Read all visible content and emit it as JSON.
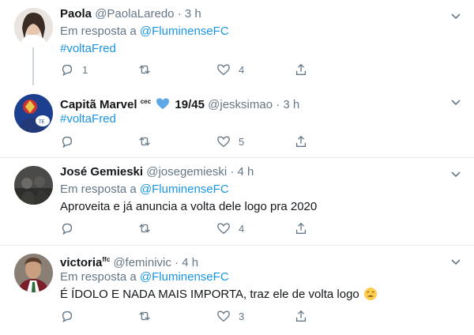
{
  "reply_prefix": "Em resposta a",
  "tweets": [
    {
      "name": "Paola",
      "handle": "@PaolaLaredo",
      "dot": "·",
      "time": "3 h",
      "reply_to": "@FluminenseFC",
      "text": "#voltaFred",
      "replies": "1",
      "retweets": "",
      "likes": "4"
    },
    {
      "name": "Capitã Marvel",
      "name_super": "cec",
      "name_suffix": "19/45",
      "handle": "@jesksimao",
      "dot": "·",
      "time": "3 h",
      "text": "#voltaFred",
      "replies": "",
      "retweets": "",
      "likes": "5"
    },
    {
      "name": "José Gemieski",
      "handle": "@josegemieski",
      "dot": "·",
      "time": "4 h",
      "reply_to": "@FluminenseFC",
      "text": "Aproveita e já anuncia a volta dele logo pra 2020",
      "replies": "",
      "retweets": "",
      "likes": "4"
    },
    {
      "name": "victoria",
      "name_super": "ffc",
      "handle": "@feminivic",
      "dot": "·",
      "time": "4 h",
      "reply_to": "@FluminenseFC",
      "text": "É ÍDOLO E NADA MAIS IMPORTA, traz ele de volta logo",
      "replies": "",
      "retweets": "",
      "likes": "3"
    }
  ],
  "colors": {
    "link": "#1b95e0",
    "secondary_text": "#657786",
    "heart": "#5fa8e8",
    "separator": "#e6ecf0"
  }
}
